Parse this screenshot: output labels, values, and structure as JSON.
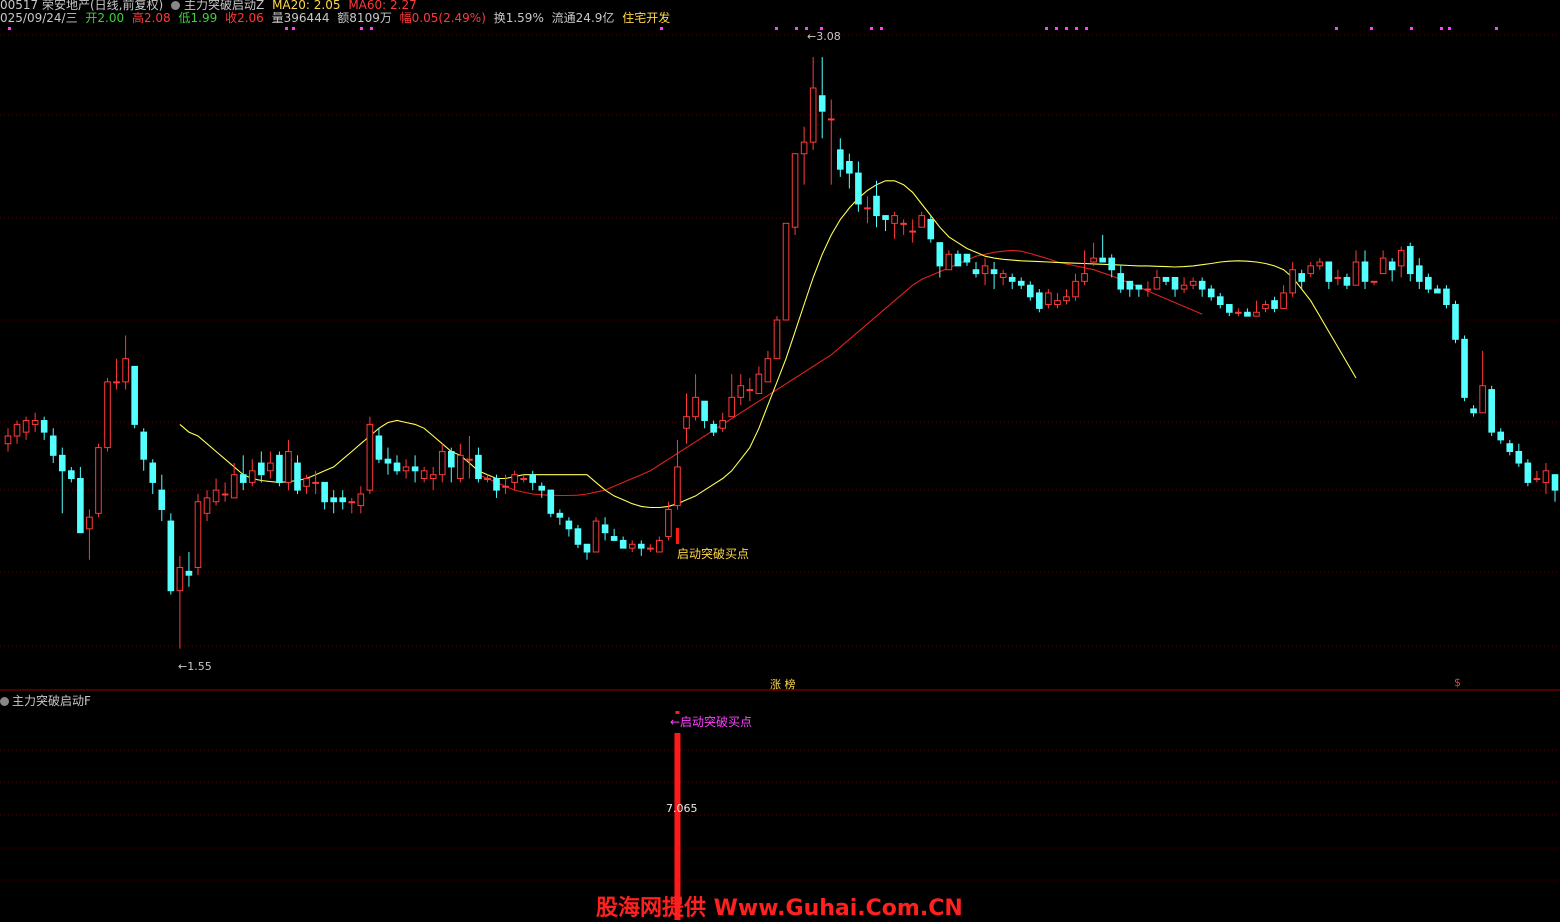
{
  "header": {
    "line1": {
      "stock": "00517 荣安地产(日线,前复权)",
      "indicator_name": "主力突破启动Z",
      "ma20_label": "MA20: 2.05",
      "ma60_label": "MA60: 2.27"
    },
    "line2": {
      "date": "025/09/24/三",
      "open": "开2.00",
      "high": "高2.08",
      "low": "低1.99",
      "close": "收2.06",
      "volume": "量396444",
      "amount": "额8109万",
      "change": "幅0.05(2.49%)",
      "turnover": "换1.59%",
      "float_mv": "流通24.9亿",
      "sector": "住宅开发"
    }
  },
  "annotations": {
    "main_buy": "启动突破买点",
    "high_price": "3.08",
    "low_price": "1.55",
    "zhang_label": "涨 榜",
    "dollar_mark": "$",
    "sub_buy": "←启动突破买点",
    "sub_value": "7.065"
  },
  "sub_panel": {
    "title": "主力突破启动F"
  },
  "watermark": "股海网提供 Www.Guhai.Com.CN",
  "colors": {
    "up": "#ff3a3a",
    "down": "#54ffff",
    "ma20": "#ffff55",
    "ma60": "#e02020",
    "grid": "#5a0000",
    "signal_magenta": "#ff40ff"
  },
  "chart_data": {
    "type": "candlestick",
    "ylim": [
      1.5,
      3.15
    ],
    "candles": [
      {
        "o": 2.08,
        "c": 2.1,
        "h": 2.12,
        "l": 2.06
      },
      {
        "o": 2.1,
        "c": 2.13,
        "h": 2.14,
        "l": 2.08
      },
      {
        "o": 2.11,
        "c": 2.14,
        "h": 2.15,
        "l": 2.09
      },
      {
        "o": 2.13,
        "c": 2.14,
        "h": 2.16,
        "l": 2.11
      },
      {
        "o": 2.14,
        "c": 2.11,
        "h": 2.15,
        "l": 2.09
      },
      {
        "o": 2.1,
        "c": 2.05,
        "h": 2.12,
        "l": 2.03
      },
      {
        "o": 2.05,
        "c": 2.01,
        "h": 2.07,
        "l": 1.9
      },
      {
        "o": 2.01,
        "c": 1.99,
        "h": 2.02,
        "l": 1.98
      },
      {
        "o": 1.99,
        "c": 1.85,
        "h": 2.02,
        "l": 1.85
      },
      {
        "o": 1.86,
        "c": 1.89,
        "h": 1.91,
        "l": 1.78
      },
      {
        "o": 1.9,
        "c": 2.07,
        "h": 2.08,
        "l": 1.89
      },
      {
        "o": 2.07,
        "c": 2.24,
        "h": 2.25,
        "l": 2.06
      },
      {
        "o": 2.24,
        "c": 2.24,
        "h": 2.3,
        "l": 2.22
      },
      {
        "o": 2.24,
        "c": 2.3,
        "h": 2.36,
        "l": 2.22
      },
      {
        "o": 2.28,
        "c": 2.13,
        "h": 2.28,
        "l": 2.12
      },
      {
        "o": 2.11,
        "c": 2.04,
        "h": 2.12,
        "l": 2.01
      },
      {
        "o": 2.03,
        "c": 1.98,
        "h": 2.04,
        "l": 1.95
      },
      {
        "o": 1.96,
        "c": 1.91,
        "h": 2.0,
        "l": 1.88
      },
      {
        "o": 1.88,
        "c": 1.7,
        "h": 1.9,
        "l": 1.69
      },
      {
        "o": 1.7,
        "c": 1.76,
        "h": 1.79,
        "l": 1.55
      },
      {
        "o": 1.75,
        "c": 1.74,
        "h": 1.8,
        "l": 1.71
      },
      {
        "o": 1.76,
        "c": 1.93,
        "h": 1.95,
        "l": 1.74
      },
      {
        "o": 1.9,
        "c": 1.94,
        "h": 1.96,
        "l": 1.88
      },
      {
        "o": 1.93,
        "c": 1.96,
        "h": 1.99,
        "l": 1.92
      },
      {
        "o": 1.95,
        "c": 1.95,
        "h": 1.98,
        "l": 1.93
      },
      {
        "o": 1.94,
        "c": 2.0,
        "h": 2.03,
        "l": 1.94
      },
      {
        "o": 2.0,
        "c": 1.98,
        "h": 2.05,
        "l": 1.96
      },
      {
        "o": 1.98,
        "c": 2.01,
        "h": 2.04,
        "l": 1.97
      },
      {
        "o": 2.03,
        "c": 2.0,
        "h": 2.06,
        "l": 1.98
      },
      {
        "o": 2.01,
        "c": 2.03,
        "h": 2.06,
        "l": 1.99
      },
      {
        "o": 2.05,
        "c": 1.98,
        "h": 2.06,
        "l": 1.97
      },
      {
        "o": 1.98,
        "c": 2.06,
        "h": 2.09,
        "l": 1.96
      },
      {
        "o": 2.03,
        "c": 1.96,
        "h": 2.05,
        "l": 1.95
      },
      {
        "o": 1.97,
        "c": 1.99,
        "h": 2.0,
        "l": 1.95
      },
      {
        "o": 1.98,
        "c": 1.98,
        "h": 2.01,
        "l": 1.95
      },
      {
        "o": 1.98,
        "c": 1.93,
        "h": 1.98,
        "l": 1.91
      },
      {
        "o": 1.94,
        "c": 1.93,
        "h": 1.96,
        "l": 1.9
      },
      {
        "o": 1.94,
        "c": 1.93,
        "h": 1.96,
        "l": 1.91
      },
      {
        "o": 1.93,
        "c": 1.93,
        "h": 1.94,
        "l": 1.9
      },
      {
        "o": 1.92,
        "c": 1.95,
        "h": 1.97,
        "l": 1.9
      },
      {
        "o": 1.96,
        "c": 2.13,
        "h": 2.15,
        "l": 1.95
      },
      {
        "o": 2.1,
        "c": 2.04,
        "h": 2.12,
        "l": 2.03
      },
      {
        "o": 2.04,
        "c": 2.03,
        "h": 2.07,
        "l": 2.0
      },
      {
        "o": 2.03,
        "c": 2.01,
        "h": 2.05,
        "l": 2.0
      },
      {
        "o": 2.01,
        "c": 2.02,
        "h": 2.04,
        "l": 1.99
      },
      {
        "o": 2.02,
        "c": 2.01,
        "h": 2.05,
        "l": 1.98
      },
      {
        "o": 1.99,
        "c": 2.01,
        "h": 2.02,
        "l": 1.98
      },
      {
        "o": 1.99,
        "c": 2.0,
        "h": 2.02,
        "l": 1.96
      },
      {
        "o": 2.0,
        "c": 2.06,
        "h": 2.08,
        "l": 1.98
      },
      {
        "o": 2.06,
        "c": 2.02,
        "h": 2.07,
        "l": 1.98
      },
      {
        "o": 1.99,
        "c": 2.05,
        "h": 2.08,
        "l": 1.98
      },
      {
        "o": 2.04,
        "c": 2.04,
        "h": 2.1,
        "l": 1.99
      },
      {
        "o": 2.05,
        "c": 1.99,
        "h": 2.07,
        "l": 1.98
      },
      {
        "o": 1.99,
        "c": 1.99,
        "h": 2.0,
        "l": 1.98
      },
      {
        "o": 1.99,
        "c": 1.96,
        "h": 2.0,
        "l": 1.94
      },
      {
        "o": 1.97,
        "c": 1.97,
        "h": 2.0,
        "l": 1.95
      },
      {
        "o": 1.98,
        "c": 2.0,
        "h": 2.01,
        "l": 1.96
      },
      {
        "o": 1.99,
        "c": 1.99,
        "h": 2.0,
        "l": 1.98
      },
      {
        "o": 2.0,
        "c": 1.98,
        "h": 2.01,
        "l": 1.96
      },
      {
        "o": 1.97,
        "c": 1.96,
        "h": 1.98,
        "l": 1.94
      },
      {
        "o": 1.96,
        "c": 1.9,
        "h": 1.96,
        "l": 1.89
      },
      {
        "o": 1.9,
        "c": 1.89,
        "h": 1.91,
        "l": 1.87
      },
      {
        "o": 1.88,
        "c": 1.86,
        "h": 1.89,
        "l": 1.84
      },
      {
        "o": 1.86,
        "c": 1.82,
        "h": 1.87,
        "l": 1.81
      },
      {
        "o": 1.82,
        "c": 1.8,
        "h": 1.82,
        "l": 1.78
      },
      {
        "o": 1.8,
        "c": 1.88,
        "h": 1.89,
        "l": 1.8
      },
      {
        "o": 1.87,
        "c": 1.85,
        "h": 1.89,
        "l": 1.83
      },
      {
        "o": 1.84,
        "c": 1.83,
        "h": 1.86,
        "l": 1.83
      },
      {
        "o": 1.83,
        "c": 1.81,
        "h": 1.84,
        "l": 1.81
      },
      {
        "o": 1.81,
        "c": 1.82,
        "h": 1.83,
        "l": 1.8
      },
      {
        "o": 1.82,
        "c": 1.81,
        "h": 1.83,
        "l": 1.79
      },
      {
        "o": 1.81,
        "c": 1.81,
        "h": 1.82,
        "l": 1.8
      },
      {
        "o": 1.8,
        "c": 1.83,
        "h": 1.84,
        "l": 1.8
      },
      {
        "o": 1.84,
        "c": 1.91,
        "h": 1.93,
        "l": 1.83
      },
      {
        "o": 1.92,
        "c": 2.02,
        "h": 2.09,
        "l": 1.91
      },
      {
        "o": 2.12,
        "c": 2.15,
        "h": 2.21,
        "l": 2.08
      },
      {
        "o": 2.15,
        "c": 2.2,
        "h": 2.26,
        "l": 2.14
      },
      {
        "o": 2.19,
        "c": 2.14,
        "h": 2.19,
        "l": 2.12
      },
      {
        "o": 2.13,
        "c": 2.11,
        "h": 2.14,
        "l": 2.1
      },
      {
        "o": 2.12,
        "c": 2.14,
        "h": 2.16,
        "l": 2.11
      },
      {
        "o": 2.15,
        "c": 2.2,
        "h": 2.26,
        "l": 2.15
      },
      {
        "o": 2.2,
        "c": 2.23,
        "h": 2.26,
        "l": 2.18
      },
      {
        "o": 2.22,
        "c": 2.22,
        "h": 2.25,
        "l": 2.19
      },
      {
        "o": 2.21,
        "c": 2.26,
        "h": 2.28,
        "l": 2.21
      },
      {
        "o": 2.24,
        "c": 2.3,
        "h": 2.32,
        "l": 2.24
      },
      {
        "o": 2.3,
        "c": 2.4,
        "h": 2.41,
        "l": 2.3
      },
      {
        "o": 2.4,
        "c": 2.65,
        "h": 2.65,
        "l": 2.4
      },
      {
        "o": 2.64,
        "c": 2.83,
        "h": 2.83,
        "l": 2.62
      },
      {
        "o": 2.83,
        "c": 2.86,
        "h": 2.9,
        "l": 2.75
      },
      {
        "o": 2.86,
        "c": 3.0,
        "h": 3.08,
        "l": 2.84
      },
      {
        "o": 2.98,
        "c": 2.94,
        "h": 3.08,
        "l": 2.87
      },
      {
        "o": 2.92,
        "c": 2.92,
        "h": 2.97,
        "l": 2.75
      },
      {
        "o": 2.84,
        "c": 2.79,
        "h": 2.87,
        "l": 2.77
      },
      {
        "o": 2.81,
        "c": 2.78,
        "h": 2.83,
        "l": 2.74
      },
      {
        "o": 2.78,
        "c": 2.7,
        "h": 2.81,
        "l": 2.68
      },
      {
        "o": 2.69,
        "c": 2.69,
        "h": 2.72,
        "l": 2.65
      },
      {
        "o": 2.72,
        "c": 2.67,
        "h": 2.76,
        "l": 2.64
      },
      {
        "o": 2.67,
        "c": 2.66,
        "h": 2.67,
        "l": 2.63
      },
      {
        "o": 2.65,
        "c": 2.67,
        "h": 2.68,
        "l": 2.61
      },
      {
        "o": 2.65,
        "c": 2.65,
        "h": 2.66,
        "l": 2.62
      },
      {
        "o": 2.63,
        "c": 2.63,
        "h": 2.66,
        "l": 2.6
      },
      {
        "o": 2.64,
        "c": 2.67,
        "h": 2.68,
        "l": 2.64
      },
      {
        "o": 2.66,
        "c": 2.61,
        "h": 2.67,
        "l": 2.6
      },
      {
        "o": 2.6,
        "c": 2.54,
        "h": 2.6,
        "l": 2.51
      },
      {
        "o": 2.53,
        "c": 2.57,
        "h": 2.58,
        "l": 2.53
      },
      {
        "o": 2.57,
        "c": 2.54,
        "h": 2.58,
        "l": 2.54
      },
      {
        "o": 2.57,
        "c": 2.55,
        "h": 2.57,
        "l": 2.54
      },
      {
        "o": 2.53,
        "c": 2.52,
        "h": 2.55,
        "l": 2.51
      },
      {
        "o": 2.52,
        "c": 2.54,
        "h": 2.56,
        "l": 2.49
      },
      {
        "o": 2.53,
        "c": 2.52,
        "h": 2.55,
        "l": 2.48
      },
      {
        "o": 2.51,
        "c": 2.52,
        "h": 2.53,
        "l": 2.49
      },
      {
        "o": 2.51,
        "c": 2.5,
        "h": 2.52,
        "l": 2.48
      },
      {
        "o": 2.5,
        "c": 2.49,
        "h": 2.51,
        "l": 2.48
      },
      {
        "o": 2.49,
        "c": 2.46,
        "h": 2.5,
        "l": 2.45
      },
      {
        "o": 2.47,
        "c": 2.43,
        "h": 2.48,
        "l": 2.42
      },
      {
        "o": 2.44,
        "c": 2.47,
        "h": 2.48,
        "l": 2.43
      },
      {
        "o": 2.44,
        "c": 2.45,
        "h": 2.47,
        "l": 2.43
      },
      {
        "o": 2.45,
        "c": 2.46,
        "h": 2.48,
        "l": 2.44
      },
      {
        "o": 2.46,
        "c": 2.5,
        "h": 2.52,
        "l": 2.45
      },
      {
        "o": 2.5,
        "c": 2.52,
        "h": 2.58,
        "l": 2.49
      },
      {
        "o": 2.55,
        "c": 2.56,
        "h": 2.6,
        "l": 2.54
      },
      {
        "o": 2.56,
        "c": 2.55,
        "h": 2.62,
        "l": 2.55
      },
      {
        "o": 2.56,
        "c": 2.53,
        "h": 2.57,
        "l": 2.51
      },
      {
        "o": 2.52,
        "c": 2.48,
        "h": 2.54,
        "l": 2.47
      },
      {
        "o": 2.5,
        "c": 2.48,
        "h": 2.5,
        "l": 2.46
      },
      {
        "o": 2.49,
        "c": 2.48,
        "h": 2.49,
        "l": 2.46
      },
      {
        "o": 2.48,
        "c": 2.48,
        "h": 2.5,
        "l": 2.46
      },
      {
        "o": 2.48,
        "c": 2.51,
        "h": 2.53,
        "l": 2.48
      },
      {
        "o": 2.51,
        "c": 2.5,
        "h": 2.51,
        "l": 2.49
      },
      {
        "o": 2.51,
        "c": 2.48,
        "h": 2.51,
        "l": 2.46
      },
      {
        "o": 2.48,
        "c": 2.49,
        "h": 2.51,
        "l": 2.47
      },
      {
        "o": 2.49,
        "c": 2.5,
        "h": 2.51,
        "l": 2.48
      },
      {
        "o": 2.5,
        "c": 2.48,
        "h": 2.51,
        "l": 2.46
      },
      {
        "o": 2.48,
        "c": 2.46,
        "h": 2.49,
        "l": 2.45
      },
      {
        "o": 2.46,
        "c": 2.44,
        "h": 2.47,
        "l": 2.43
      },
      {
        "o": 2.44,
        "c": 2.42,
        "h": 2.44,
        "l": 2.41
      },
      {
        "o": 2.42,
        "c": 2.42,
        "h": 2.43,
        "l": 2.41
      },
      {
        "o": 2.42,
        "c": 2.41,
        "h": 2.43,
        "l": 2.41
      },
      {
        "o": 2.41,
        "c": 2.42,
        "h": 2.45,
        "l": 2.41
      },
      {
        "o": 2.43,
        "c": 2.44,
        "h": 2.45,
        "l": 2.42
      },
      {
        "o": 2.45,
        "c": 2.43,
        "h": 2.46,
        "l": 2.42
      },
      {
        "o": 2.43,
        "c": 2.47,
        "h": 2.49,
        "l": 2.43
      },
      {
        "o": 2.47,
        "c": 2.53,
        "h": 2.55,
        "l": 2.46
      },
      {
        "o": 2.52,
        "c": 2.5,
        "h": 2.53,
        "l": 2.48
      },
      {
        "o": 2.52,
        "c": 2.54,
        "h": 2.55,
        "l": 2.51
      },
      {
        "o": 2.54,
        "c": 2.55,
        "h": 2.56,
        "l": 2.53
      },
      {
        "o": 2.55,
        "c": 2.5,
        "h": 2.55,
        "l": 2.48
      },
      {
        "o": 2.51,
        "c": 2.51,
        "h": 2.53,
        "l": 2.49
      },
      {
        "o": 2.51,
        "c": 2.49,
        "h": 2.52,
        "l": 2.48
      },
      {
        "o": 2.49,
        "c": 2.55,
        "h": 2.58,
        "l": 2.49
      },
      {
        "o": 2.55,
        "c": 2.5,
        "h": 2.58,
        "l": 2.48
      },
      {
        "o": 2.5,
        "c": 2.5,
        "h": 2.5,
        "l": 2.49
      },
      {
        "o": 2.52,
        "c": 2.56,
        "h": 2.58,
        "l": 2.52
      },
      {
        "o": 2.55,
        "c": 2.53,
        "h": 2.56,
        "l": 2.5
      },
      {
        "o": 2.54,
        "c": 2.58,
        "h": 2.59,
        "l": 2.51
      },
      {
        "o": 2.59,
        "c": 2.52,
        "h": 2.6,
        "l": 2.5
      },
      {
        "o": 2.54,
        "c": 2.5,
        "h": 2.56,
        "l": 2.48
      },
      {
        "o": 2.51,
        "c": 2.48,
        "h": 2.52,
        "l": 2.47
      },
      {
        "o": 2.48,
        "c": 2.47,
        "h": 2.49,
        "l": 2.47
      },
      {
        "o": 2.48,
        "c": 2.44,
        "h": 2.49,
        "l": 2.43
      },
      {
        "o": 2.44,
        "c": 2.35,
        "h": 2.45,
        "l": 2.34
      },
      {
        "o": 2.35,
        "c": 2.2,
        "h": 2.36,
        "l": 2.19
      },
      {
        "o": 2.17,
        "c": 2.16,
        "h": 2.18,
        "l": 2.15
      },
      {
        "o": 2.16,
        "c": 2.23,
        "h": 2.32,
        "l": 2.16
      },
      {
        "o": 2.22,
        "c": 2.11,
        "h": 2.23,
        "l": 2.1
      },
      {
        "o": 2.11,
        "c": 2.09,
        "h": 2.12,
        "l": 2.08
      },
      {
        "o": 2.08,
        "c": 2.06,
        "h": 2.09,
        "l": 2.05
      },
      {
        "o": 2.06,
        "c": 2.03,
        "h": 2.08,
        "l": 2.02
      },
      {
        "o": 2.03,
        "c": 1.98,
        "h": 2.04,
        "l": 1.97
      },
      {
        "o": 1.99,
        "c": 1.99,
        "h": 2.01,
        "l": 1.98
      },
      {
        "o": 1.98,
        "c": 2.01,
        "h": 2.03,
        "l": 1.95
      },
      {
        "o": 2.0,
        "c": 1.96,
        "h": 2.0,
        "l": 1.93
      }
    ],
    "ma20": [
      2.13,
      2.11,
      2.1,
      2.08,
      2.06,
      2.04,
      2.02,
      2.0,
      1.99,
      1.985,
      1.982,
      1.98,
      1.982,
      1.985,
      1.99,
      2.0,
      2.01,
      2.02,
      2.04,
      2.06,
      2.08,
      2.1,
      2.12,
      2.135,
      2.14,
      2.135,
      2.13,
      2.12,
      2.1,
      2.08,
      2.06,
      2.05,
      2.03,
      2.01,
      2.0,
      1.99,
      1.99,
      1.995,
      2.0,
      2.0,
      2.0,
      2.0,
      2.0,
      2.0,
      2.0,
      2.0,
      1.98,
      1.96,
      1.945,
      1.935,
      1.925,
      1.918,
      1.915,
      1.915,
      1.918,
      1.925,
      1.935,
      1.945,
      1.96,
      1.975,
      1.99,
      2.01,
      2.04,
      2.07,
      2.12,
      2.18,
      2.24,
      2.3,
      2.37,
      2.44,
      2.51,
      2.57,
      2.62,
      2.66,
      2.69,
      2.715,
      2.735,
      2.75,
      2.76,
      2.76,
      2.75,
      2.73,
      2.7,
      2.67,
      2.64,
      2.615,
      2.6,
      2.585,
      2.575,
      2.565,
      2.56,
      2.557,
      2.555,
      2.553,
      2.552,
      2.551,
      2.55,
      2.549,
      2.548,
      2.547,
      2.546,
      2.545,
      2.544,
      2.543,
      2.542,
      2.541,
      2.54,
      2.54,
      2.539,
      2.538,
      2.537,
      2.538,
      2.54,
      2.543,
      2.546,
      2.55,
      2.552,
      2.553,
      2.552,
      2.55,
      2.546,
      2.54,
      2.53,
      2.51,
      2.48,
      2.45,
      2.41,
      2.37,
      2.33,
      2.29,
      2.25
    ],
    "ma60": [
      2.0,
      1.99,
      1.98,
      1.97,
      1.96,
      1.955,
      1.95,
      1.948,
      1.947,
      1.946,
      1.946,
      1.947,
      1.95,
      1.955,
      1.96,
      1.97,
      1.98,
      1.99,
      2.0,
      2.01,
      2.025,
      2.04,
      2.055,
      2.07,
      2.085,
      2.1,
      2.115,
      2.13,
      2.145,
      2.16,
      2.175,
      2.19,
      2.205,
      2.22,
      2.235,
      2.25,
      2.265,
      2.28,
      2.295,
      2.31,
      2.33,
      2.35,
      2.37,
      2.39,
      2.41,
      2.43,
      2.45,
      2.47,
      2.49,
      2.505,
      2.515,
      2.525,
      2.535,
      2.545,
      2.555,
      2.565,
      2.57,
      2.575,
      2.578,
      2.58,
      2.578,
      2.572,
      2.565,
      2.558,
      2.55,
      2.545,
      2.54,
      2.535,
      2.53,
      2.522,
      2.514,
      2.505,
      2.495,
      2.485,
      2.475,
      2.465,
      2.455,
      2.445,
      2.435,
      2.425,
      2.415
    ],
    "signal": {
      "index": 74,
      "value": 7.065
    }
  }
}
